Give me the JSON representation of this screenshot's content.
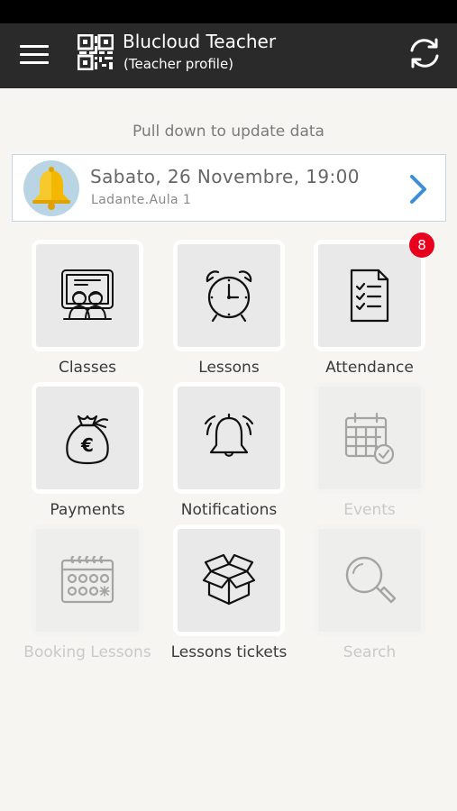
{
  "app_bar": {
    "title": "Blucloud Teacher",
    "subtitle": "(Teacher profile)",
    "menu_icon": "hamburger-menu-icon",
    "logo_icon": "qr-code-icon",
    "refresh_icon": "refresh-icon"
  },
  "pull_hint": "Pull down to update data",
  "next_lesson": {
    "date": "Sabato, 26 Novembre, 19:00",
    "room": "Ladante.Aula 1",
    "icon": "bell-icon",
    "arrow_icon": "chevron-right-icon"
  },
  "colors": {
    "app_bar": "#2a2a2a",
    "background": "#f6f5f2",
    "accent_blue": "#3a8fd6",
    "badge_red": "#e8001c",
    "bell_yellow": "#f5b800"
  },
  "menu": [
    {
      "id": "classes",
      "label": "Classes",
      "icon": "classroom-icon",
      "enabled": true
    },
    {
      "id": "lessons",
      "label": "Lessons",
      "icon": "alarm-clock-icon",
      "enabled": true
    },
    {
      "id": "attendance",
      "label": "Attendance",
      "icon": "checklist-icon",
      "enabled": true,
      "badge": "8"
    },
    {
      "id": "payments",
      "label": "Payments",
      "icon": "money-bag-icon",
      "enabled": true
    },
    {
      "id": "notifications",
      "label": "Notifications",
      "icon": "ringing-bell-icon",
      "enabled": true
    },
    {
      "id": "events",
      "label": "Events",
      "icon": "calendar-check-icon",
      "enabled": false
    },
    {
      "id": "booking_lessons",
      "label": "Booking Lessons",
      "icon": "booking-calendar-icon",
      "enabled": false
    },
    {
      "id": "lessons_tickets",
      "label": "Lessons tickets",
      "icon": "open-box-icon",
      "enabled": true
    },
    {
      "id": "search",
      "label": "Search",
      "icon": "magnifier-icon",
      "enabled": false
    }
  ]
}
